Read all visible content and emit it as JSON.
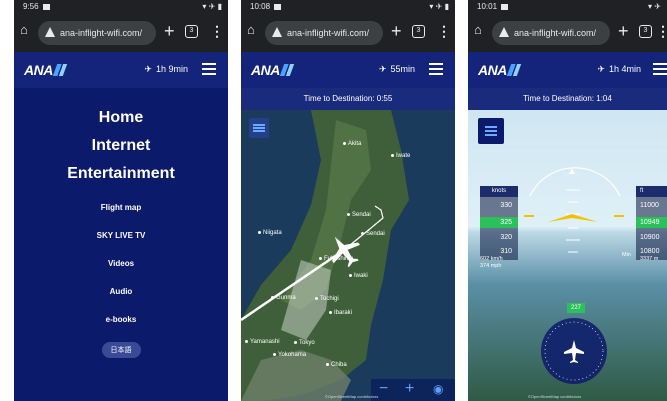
{
  "screens": [
    {
      "status_time": "9:56",
      "url": "ana-inflight-wifi.com/",
      "tab_count": "3",
      "flight_time": "1h 9min",
      "menu": {
        "home": "Home",
        "internet": "Internet",
        "entertainment": "Entertainment",
        "items": [
          "Flight map",
          "SKY LIVE TV",
          "Videos",
          "Audio",
          "e-books"
        ],
        "language_button": "日本語"
      }
    },
    {
      "status_time": "10:08",
      "url": "ana-inflight-wifi.com/",
      "tab_count": "3",
      "flight_time": "55min",
      "time_to_destination": "Time to Destination: 0:55",
      "cities": [
        "Akita",
        "Iwate",
        "Niigata",
        "Sendai",
        "Sendai",
        "Fukushima",
        "Iwaki",
        "Gunma",
        "Tochigi",
        "Ibaraki",
        "Yamanashi",
        "Tokyo",
        "Yokohama",
        "Chiba"
      ],
      "credit": "©OpenStreetMap contributors"
    },
    {
      "status_time": "10:01",
      "url": "ana-inflight-wifi.com/",
      "tab_count": "3",
      "flight_time": "1h 4min",
      "time_to_destination": "Time to Destination: 1:04",
      "speed": {
        "unit": "knots",
        "ticks": [
          "330",
          "320",
          "310"
        ],
        "current": "325",
        "kmh": "602 km/h",
        "mph": "374 mph"
      },
      "altitude": {
        "unit": "ft",
        "ticks": [
          "11000",
          "10900",
          "10800"
        ],
        "current": "10949",
        "meters": "3337 m",
        "min_label": "Min"
      },
      "heading": "227",
      "credit": "©OpenStreetMap contributors"
    }
  ],
  "colors": {
    "ana_navy": "#0c1a6b",
    "chrome_bar": "#202124",
    "speed_green": "#2cc05a",
    "aircraft_yellow": "#f2c200"
  }
}
